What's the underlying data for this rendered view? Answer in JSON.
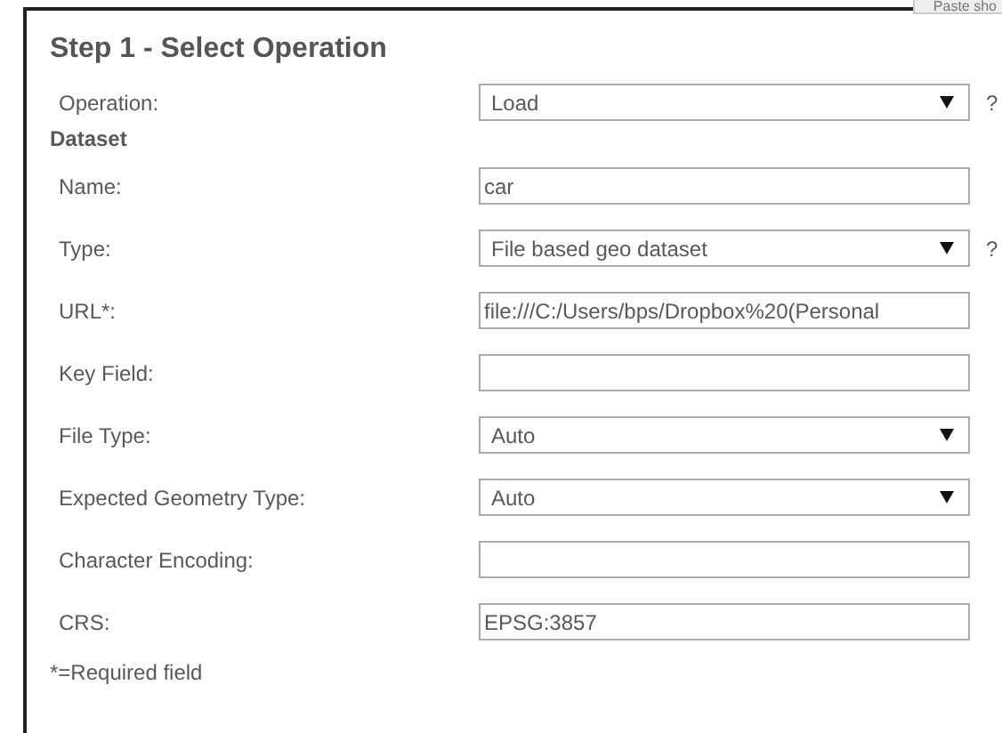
{
  "background_button": "Paste sho",
  "title": "Step 1 - Select Operation",
  "rows": [
    {
      "kind": "select",
      "label": "Operation:",
      "value": "Load",
      "help": "?"
    },
    {
      "kind": "heading",
      "label": "Dataset"
    },
    {
      "kind": "text",
      "label": "Name:",
      "value": "car"
    },
    {
      "kind": "select",
      "label": "Type:",
      "value": "File based geo dataset",
      "help": "?"
    },
    {
      "kind": "text",
      "label": "URL*:",
      "value": "file:///C:/Users/bps/Dropbox%20(Personal"
    },
    {
      "kind": "text",
      "label": "Key Field:"
    },
    {
      "kind": "select",
      "label": "File Type:",
      "value": "Auto"
    },
    {
      "kind": "select",
      "label": "Expected Geometry Type:",
      "value": "Auto"
    },
    {
      "kind": "text",
      "label": "Character Encoding:"
    },
    {
      "kind": "text",
      "label": "CRS:",
      "value": "EPSG:3857"
    }
  ],
  "note": "*=Required field"
}
